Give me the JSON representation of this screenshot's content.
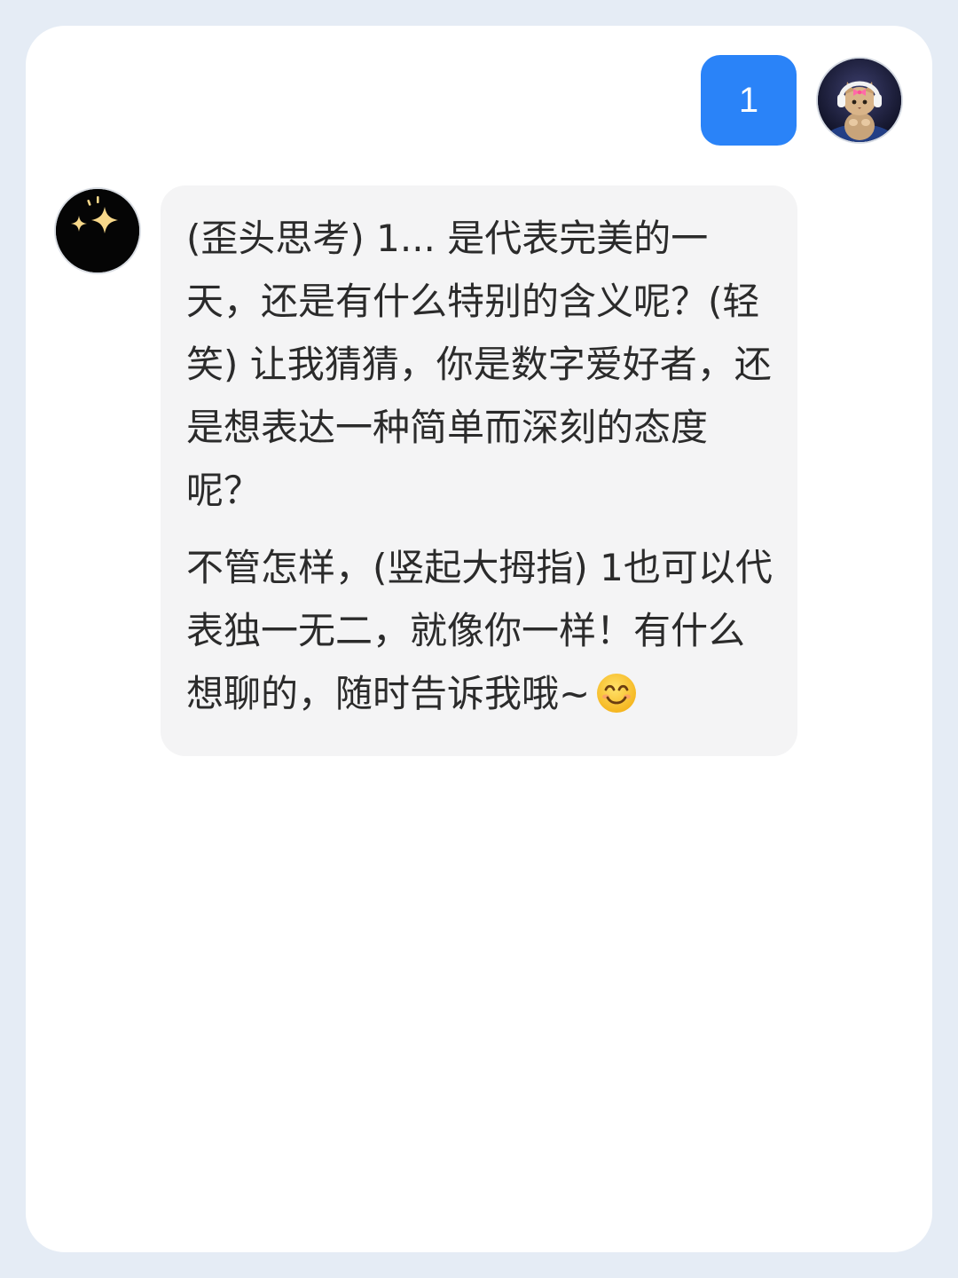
{
  "conversation": {
    "user_message": {
      "text": "1",
      "bubble_color": "#2a83f8",
      "avatar_icon": "cat-with-headphones-avatar"
    },
    "assistant_message": {
      "avatar_icon": "sparkles-avatar",
      "paragraph_1": "(歪头思考) 1... 是代表完美的一天，还是有什么特别的含义呢？(轻笑) 让我猜猜，你是数字爱好者，还是想表达一种简单而深刻的态度呢？",
      "paragraph_2": "不管怎样，(竖起大拇指) 1也可以代表独一无二，就像你一样！有什么想聊的，随时告诉我哦~",
      "trailing_emoji": "smiling-face-emoji",
      "bubble_color": "#f4f4f5"
    }
  },
  "theme": {
    "page_background": "#e5ecf5",
    "card_background": "#ffffff",
    "text_color": "#2b2b2b"
  }
}
